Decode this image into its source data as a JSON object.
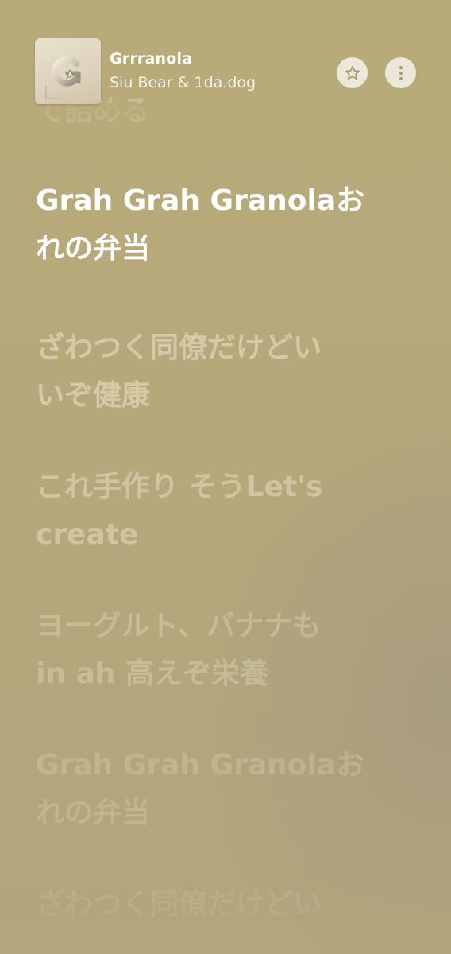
{
  "now_playing": {
    "title": "Grrranola",
    "artist": "Siu Bear & 1da.dog",
    "artwork_icon": "granola-logo-icon"
  },
  "actions": {
    "favorite_icon": "star-icon",
    "more_icon": "more-vertical-icon"
  },
  "lyrics": [
    {
      "state": "past-partial",
      "lines": [
        "で詰める"
      ]
    },
    {
      "state": "active",
      "lines": [
        "Grah Grah Granolaお",
        "れの弁当"
      ]
    },
    {
      "state": "upcoming",
      "lines": [
        "ざわつく同僚だけどい",
        "いぞ健康"
      ]
    },
    {
      "state": "upcoming",
      "lines": [
        "これ手作り そうLet's",
        "create"
      ]
    },
    {
      "state": "upcoming",
      "lines": [
        "ヨーグルト、バナナも",
        "in ah 高えぞ栄養"
      ]
    },
    {
      "state": "upcoming",
      "lines": [
        "Grah Grah Granolaお",
        "れの弁当"
      ]
    },
    {
      "state": "upcoming-partial",
      "lines": [
        "ざわつく同僚だけどい"
      ]
    }
  ],
  "colors": {
    "background": "#b8ab79",
    "active_lyric": "#ffffff",
    "inactive_lyric": "#ece4c8"
  }
}
